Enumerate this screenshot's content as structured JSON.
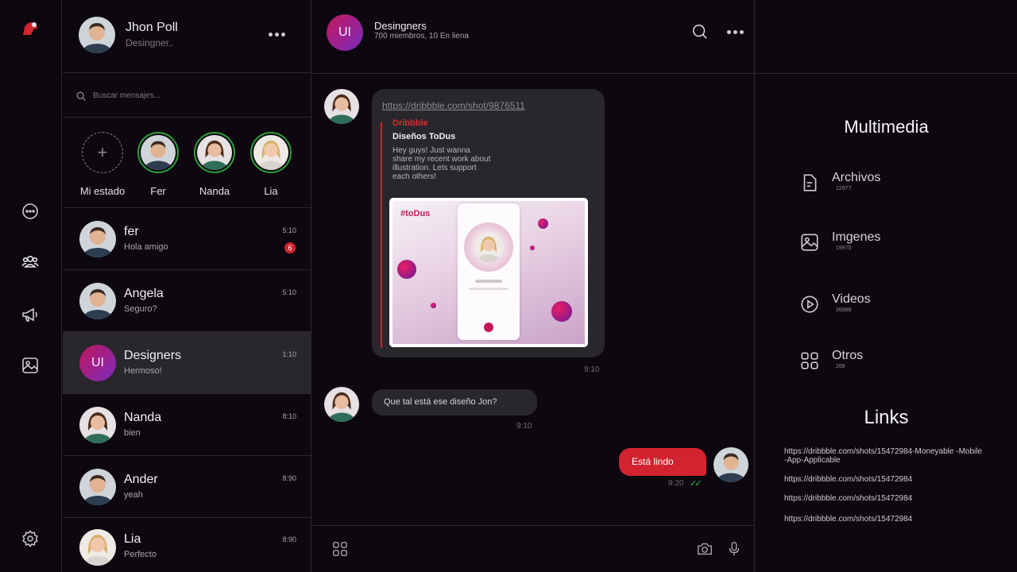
{
  "user": {
    "name": "Jhon Poll",
    "role": "Desingner.."
  },
  "search": {
    "placeholder": "Buscar mensajes..."
  },
  "stories": [
    {
      "label": "Mi estado"
    },
    {
      "label": "Fer"
    },
    {
      "label": "Nanda"
    },
    {
      "label": "Lia"
    }
  ],
  "chats": [
    {
      "name": "fer",
      "message": "Hola amigo",
      "time": "5:10",
      "unread": "6"
    },
    {
      "name": "Angela",
      "message": "Seguro?",
      "time": "5:10"
    },
    {
      "name": "Designers",
      "message": "Hermoso!",
      "time": "1:10",
      "avatar_text": "UI",
      "active": true
    },
    {
      "name": "Nanda",
      "message": "bien",
      "time": "8:10"
    },
    {
      "name": "Ander",
      "message": "yeah",
      "time": "8:90"
    },
    {
      "name": "Lia",
      "message": "Perfecto",
      "time": "8:90"
    }
  ],
  "conversation": {
    "avatar_text": "UI",
    "title": "Desingners",
    "subtitle": "700 miembros, 10 En liena",
    "link_message": {
      "url": "https://dribbble.com/shot/9876511",
      "source": "Dribbble",
      "title": "Diseños ToDus",
      "description": "Hey guys! Just wanna share my recent work about illustration. Lets support each others!",
      "preview_tag": "#toDus",
      "time": "9:10"
    },
    "question_message": {
      "text": "Que tal está ese diseño Jon?",
      "time": "9:10"
    },
    "own_message": {
      "text": "Está lindo",
      "time": "9:20",
      "status": "✓✓"
    }
  },
  "media": {
    "title": "Multimedia",
    "items": [
      {
        "label": "Archivos",
        "count": "12977",
        "icon": "file-icon"
      },
      {
        "label": "Imgenes",
        "count": "19970",
        "icon": "image-icon"
      },
      {
        "label": "Videos",
        "count": "26888",
        "icon": "play-icon"
      },
      {
        "label": "Otros",
        "count": "268",
        "icon": "grid-icon"
      }
    ],
    "links_title": "Links",
    "links": [
      "https://dribbble.com/shots/15472984-Moneyable -Mobile-App-Applicable",
      "https://dribbble.com/shots/15472984",
      "https://dribbble.com/shots/15472984",
      "https://dribbble.com/shots/15472984"
    ]
  },
  "colors": {
    "accent": "#d12430",
    "online_ring": "#2f9e3a",
    "active_row": "#29262c",
    "background": "#0d0810"
  }
}
